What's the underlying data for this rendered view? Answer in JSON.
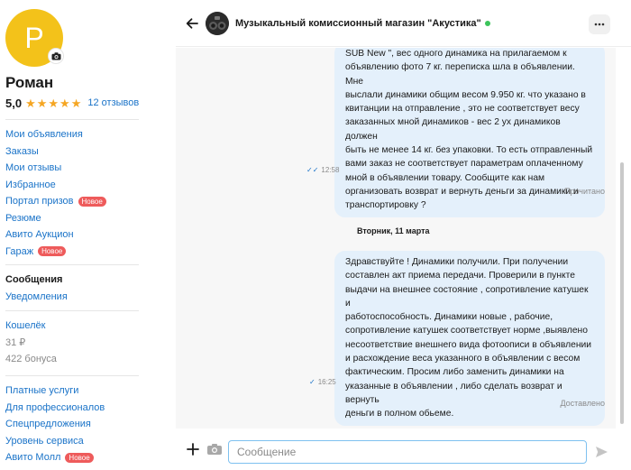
{
  "profile": {
    "avatar_letter": "Р",
    "name": "Роман",
    "rating": "5,0",
    "stars": [
      "★",
      "★",
      "★",
      "★",
      "★"
    ],
    "reviews": "12 отзывов"
  },
  "nav": {
    "group1": [
      {
        "label": "Мои объявления"
      },
      {
        "label": "Заказы"
      },
      {
        "label": "Мои отзывы"
      },
      {
        "label": "Избранное"
      },
      {
        "label": "Портал призов",
        "badge": "Новое"
      },
      {
        "label": "Резюме"
      },
      {
        "label": "Авито Аукцион"
      },
      {
        "label": "Гараж",
        "badge": "Новое"
      }
    ],
    "messages": "Сообщения",
    "notifications": "Уведомления",
    "wallet": "Кошелёк",
    "balance": "31 ₽",
    "bonus": "422 бонуса",
    "group4": [
      {
        "label": "Платные услуги"
      },
      {
        "label": "Для профессионалов"
      },
      {
        "label": "Спецпредложения"
      },
      {
        "label": "Уровень сервиса"
      },
      {
        "label": "Авито Молл",
        "badge": "Новое"
      }
    ]
  },
  "chat": {
    "title": "Музыкальный комиссионный магазин \"Акустика\"",
    "online_color": "#3cc45b",
    "date_separator": "Вторник, 11 марта",
    "messages": [
      {
        "lines": [
          "SUB New \", вес одного динамика на прилагаемом к",
          "объявлению фото 7 кг. переписка шла в объявлении. Мне",
          "выслали динамики общим весом 9.950 кг. что указано в",
          "квитанции на отправление , это не соответствует весу",
          "заказанных мной динамиков - вес 2 ух динамиков должен",
          "быть не менее 14 кг. без упаковки. То есть отправленный",
          "вами заказ не соответствует параметрам оплаченному",
          "мной в объявлении товару. Сообщите как нам",
          "организовать возврат и вернуть деньги за динамики и",
          "транспортировку ?"
        ],
        "time": "12:58",
        "status": "Прочитано"
      },
      {
        "lines": [
          "Здравствуйте ! Динамики получили. При получении",
          "составлен акт приема передачи. Проверили в пункте",
          "выдачи на внешнее состояние , сопротивление катушек и",
          "работоспособность. Динамики новые , рабочие,",
          "сопротивление катушек соответствует норме ,выявлено",
          "несоответствие внешнего вида фотоописи в объявлении",
          "и расхождение веса указанного в объявлении с весом",
          "фактическим. Просим либо заменить динамики на",
          "указанные в объявлении , либо сделать возврат и вернуть",
          "деньги в полном обьеме."
        ],
        "time": "16:25",
        "status": "Доставлено"
      }
    ]
  },
  "composer": {
    "placeholder": "Сообщение",
    "value": ""
  },
  "colors": {
    "accent": "#1a73c8",
    "avatar": "#f3c21a",
    "bubble": "#e4f0fb",
    "badge": "#ee5b5b",
    "star": "#f5a623"
  }
}
